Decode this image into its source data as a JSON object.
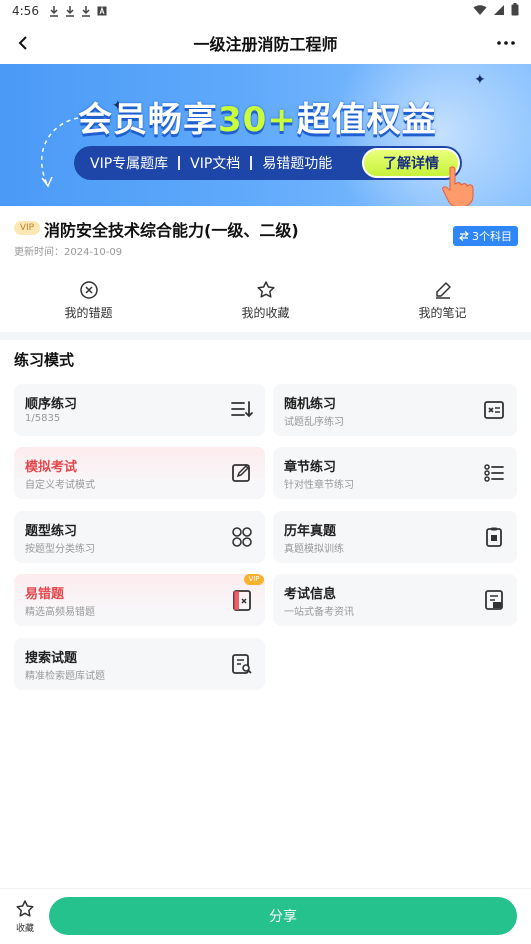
{
  "status_bar": {
    "time": "4:56"
  },
  "nav": {
    "title": "一级注册消防工程师"
  },
  "banner": {
    "title_part1": "会员畅享",
    "title_accent": "30+",
    "title_part2": "超值权益",
    "features": [
      "VIP专属题库",
      "VIP文档",
      "易错题功能"
    ],
    "cta": "了解详情"
  },
  "course": {
    "vip_tag": "VIP",
    "title": "消防安全技术综合能力(一级、二级)",
    "updated": "更新时间：2024-10-09",
    "subject_badge": "3个科目"
  },
  "quick_actions": [
    {
      "label": "我的错题",
      "icon": "wrong-answers-icon"
    },
    {
      "label": "我的收藏",
      "icon": "star-icon"
    },
    {
      "label": "我的笔记",
      "icon": "pencil-icon"
    }
  ],
  "practice": {
    "section_title": "练习模式",
    "cards": [
      {
        "title": "顺序练习",
        "sub": "1/5835",
        "icon": "sequence-list-icon",
        "highlight": false
      },
      {
        "title": "随机练习",
        "sub": "试题乱序练习",
        "icon": "shuffle-icon",
        "highlight": false
      },
      {
        "title": "模拟考试",
        "sub": "自定义考试模式",
        "icon": "exam-edit-icon",
        "highlight": true
      },
      {
        "title": "章节练习",
        "sub": "针对性章节练习",
        "icon": "chapter-list-icon",
        "highlight": false
      },
      {
        "title": "题型练习",
        "sub": "按题型分类练习",
        "icon": "grid-icon",
        "highlight": false
      },
      {
        "title": "历年真题",
        "sub": "真题模拟训练",
        "icon": "clipboard-icon",
        "highlight": false
      },
      {
        "title": "易错题",
        "sub": "精选高频易错题",
        "icon": "error-book-icon",
        "highlight": true,
        "badge": "VIP"
      },
      {
        "title": "考试信息",
        "sub": "一站式备考资讯",
        "icon": "exam-info-icon",
        "highlight": false
      },
      {
        "title": "搜索试题",
        "sub": "精准检索题库试题",
        "icon": "search-doc-icon",
        "highlight": false
      }
    ]
  },
  "bottom": {
    "favorite_label": "收藏",
    "share_label": "分享"
  },
  "colors": {
    "primary_green": "#26c28e",
    "accent_blue": "#2f86f6",
    "highlight_red": "#e5484d"
  }
}
